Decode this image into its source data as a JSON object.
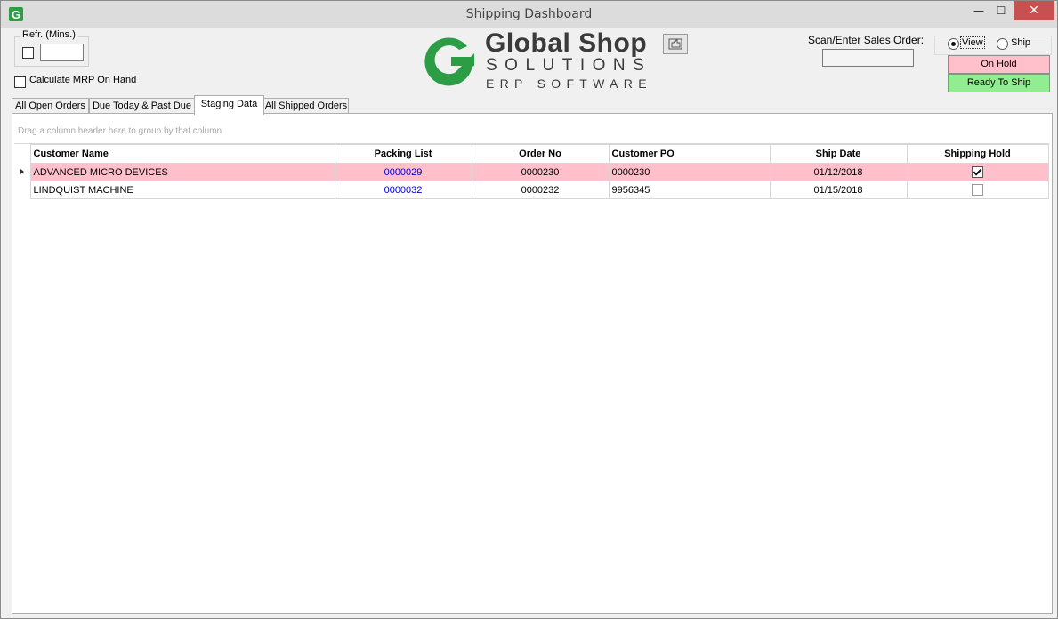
{
  "window": {
    "title": "Shipping Dashboard",
    "minimize": "—",
    "maximize": "☐",
    "close": "✕"
  },
  "refresh": {
    "label": "Refr. (Mins.)",
    "value": ""
  },
  "mrp": {
    "label": "Calculate MRP On Hand"
  },
  "logo": {
    "line1": "Global Shop",
    "line2": "SOLUTIONS",
    "line3": "ERP SOFTWARE"
  },
  "scan": {
    "label": "Scan/Enter Sales Order:",
    "value": ""
  },
  "mode": {
    "view_label": "View",
    "ship_label": "Ship",
    "selected": "View"
  },
  "legend": {
    "on_hold": "On Hold",
    "ready": "Ready To Ship",
    "on_hold_color": "#ffc0cb",
    "ready_color": "#90ee90"
  },
  "tabs": [
    {
      "label": "All Open Orders"
    },
    {
      "label": "Due Today & Past Due"
    },
    {
      "label": "Staging Data",
      "active": true
    },
    {
      "label": "All Shipped Orders"
    }
  ],
  "grid": {
    "group_hint": "Drag a column header here to group by that column",
    "columns": [
      "Customer Name",
      "Packing List",
      "Order No",
      "Customer PO",
      "Ship Date",
      "Shipping Hold"
    ],
    "rows": [
      {
        "customer": "ADVANCED MICRO DEVICES",
        "packing_list": "0000029",
        "order_no": "0000230",
        "customer_po": "0000230",
        "ship_date": "01/12/2018",
        "hold": true
      },
      {
        "customer": "LINDQUIST MACHINE",
        "packing_list": "0000032",
        "order_no": "0000232",
        "customer_po": "9956345",
        "ship_date": "01/15/2018",
        "hold": false
      }
    ]
  }
}
